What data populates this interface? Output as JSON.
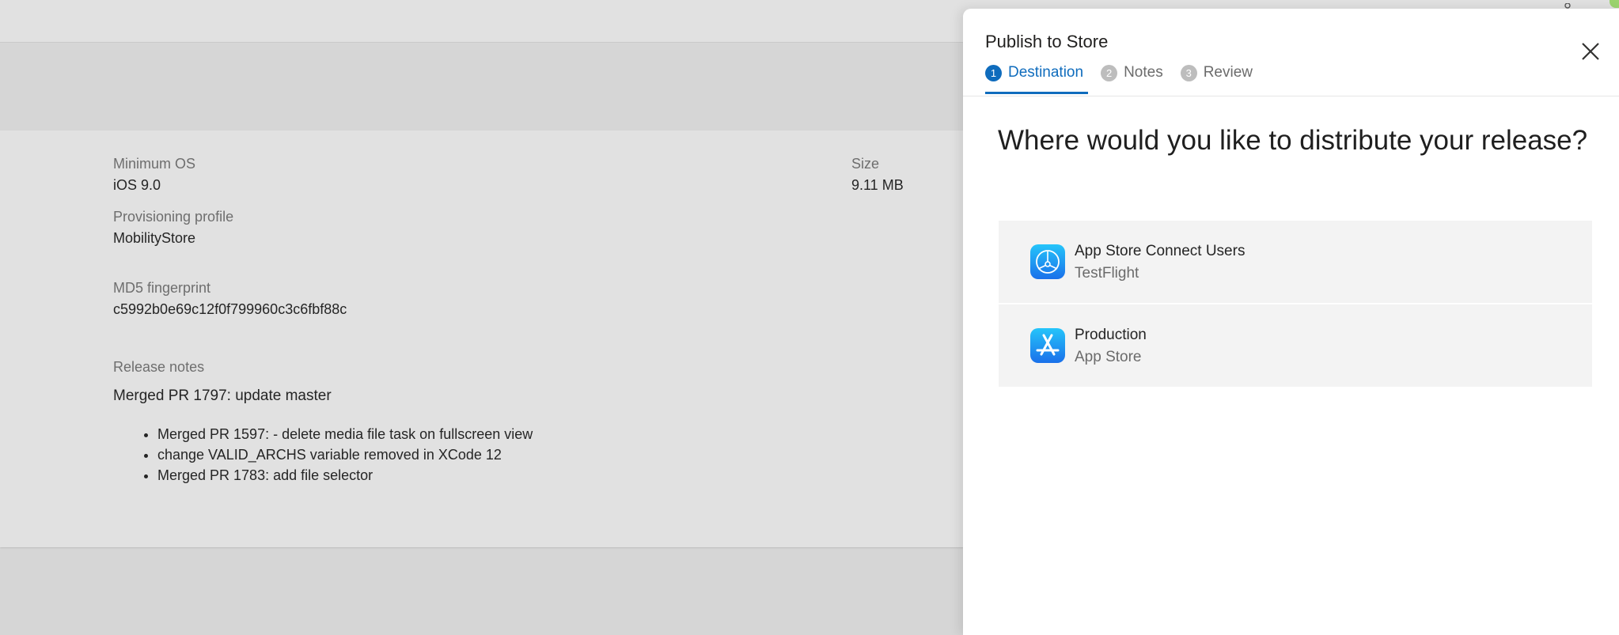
{
  "release": {
    "minimum_os_label": "Minimum OS",
    "minimum_os_value": "iOS 9.0",
    "provisioning_label": "Provisioning profile",
    "provisioning_value": "MobilityStore",
    "md5_label": "MD5 fingerprint",
    "md5_value": "c5992b0e69c12f0f799960c3c6fbf88c",
    "size_label": "Size",
    "size_value": "9.11 MB",
    "notes_label": "Release notes",
    "notes_title": "Merged PR 1797: update master",
    "notes_items": [
      "Merged PR 1597: - delete media file task on fullscreen view",
      "change VALID_ARCHS variable removed in XCode 12",
      "Merged PR 1783: add file selector"
    ]
  },
  "panel": {
    "title": "Publish to Store",
    "steps": [
      {
        "num": "1",
        "label": "Destination"
      },
      {
        "num": "2",
        "label": "Notes"
      },
      {
        "num": "3",
        "label": "Review"
      }
    ],
    "active_step": "Destination",
    "heading": "Where would you like to distribute your release?",
    "options": [
      {
        "title": "App Store Connect Users",
        "subtitle": "TestFlight",
        "icon": "testflight-icon"
      },
      {
        "title": "Production",
        "subtitle": "App Store",
        "icon": "app-store-icon"
      }
    ]
  },
  "colors": {
    "accent": "#0f6cbd",
    "option_bg": "#f3f3f3",
    "overlay_bg": "#d6d6d6"
  }
}
